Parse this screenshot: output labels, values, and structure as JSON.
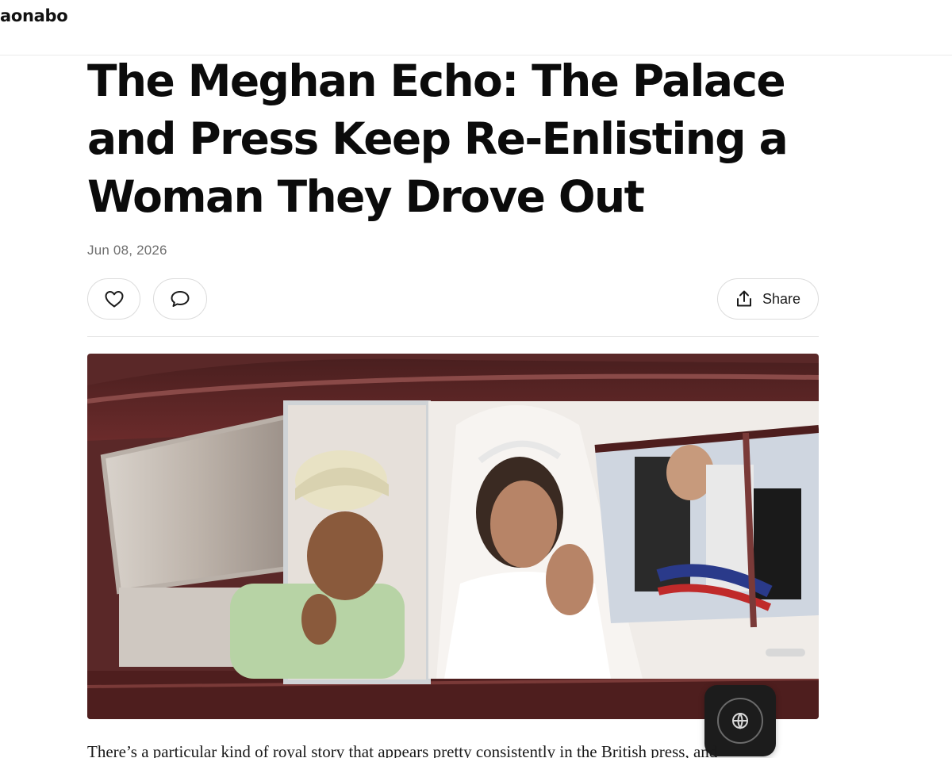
{
  "header": {
    "brand": "aonabo"
  },
  "article": {
    "title": "The Meghan Echo: The Palace and Press Keep Re-Enlisting a Woman They Drove Out",
    "date": "Jun 08, 2026",
    "body_start": "There’s a particular kind of royal story that appears pretty consistently in the British press, and"
  },
  "actions": {
    "like_icon": "heart-icon",
    "comment_icon": "speech-bubble-icon",
    "share_icon": "share-upload-icon",
    "share_label": "Share"
  },
  "floating_button": {
    "icon": "translate-icon"
  },
  "colors": {
    "text": "#0b0b0b",
    "muted": "#6f6f6f",
    "border": "#dcdcdc",
    "fab": "#1c1c1c"
  }
}
